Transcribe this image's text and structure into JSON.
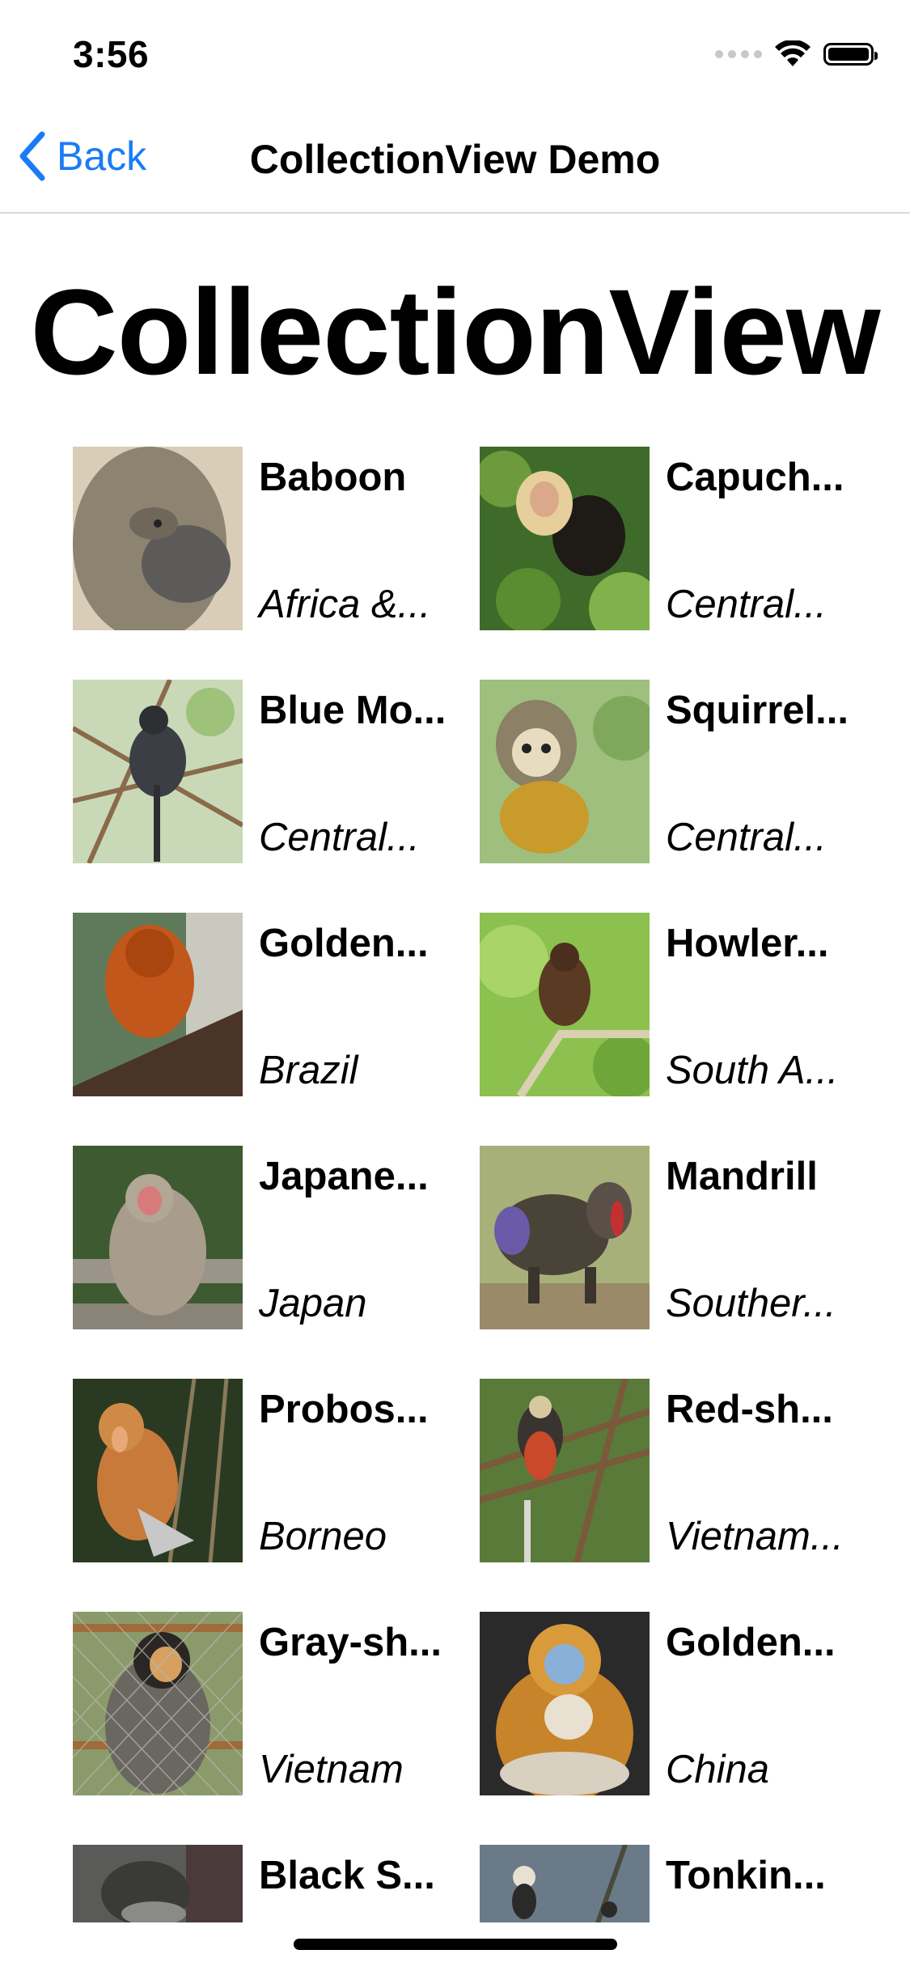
{
  "status_bar": {
    "time": "3:56",
    "icons": [
      "signal-dots-icon",
      "wifi-icon",
      "battery-icon"
    ]
  },
  "nav": {
    "back_label": "Back",
    "title": "CollectionView Demo",
    "accent_color": "#1a7cf5"
  },
  "heading": "CollectionView",
  "monkeys": [
    {
      "name": "Baboon",
      "region": "Africa &...",
      "photo": "baboon"
    },
    {
      "name": "Capuch...",
      "region": "Central...",
      "photo": "capuchin"
    },
    {
      "name": "Blue Mo...",
      "region": "Central...",
      "photo": "blue-monkey"
    },
    {
      "name": "Squirrel...",
      "region": "Central...",
      "photo": "squirrel-monkey"
    },
    {
      "name": "Golden...",
      "region": "Brazil",
      "photo": "golden-lion-tamarin"
    },
    {
      "name": "Howler...",
      "region": "South A...",
      "photo": "howler-monkey"
    },
    {
      "name": "Japane...",
      "region": "Japan",
      "photo": "japanese-macaque"
    },
    {
      "name": "Mandrill",
      "region": "Souther...",
      "photo": "mandrill"
    },
    {
      "name": "Probos...",
      "region": "Borneo",
      "photo": "proboscis-monkey"
    },
    {
      "name": "Red-sh...",
      "region": "Vietnam...",
      "photo": "red-shanked-douc"
    },
    {
      "name": "Gray-sh...",
      "region": "Vietnam",
      "photo": "gray-shanked-douc"
    },
    {
      "name": "Golden...",
      "region": "China",
      "photo": "golden-snub-nosed-monkey"
    },
    {
      "name": "Black S...",
      "region": "",
      "photo": "black-snub-nosed-monkey"
    },
    {
      "name": "Tonkin...",
      "region": "",
      "photo": "tonkin-snub-nosed-monkey"
    }
  ]
}
